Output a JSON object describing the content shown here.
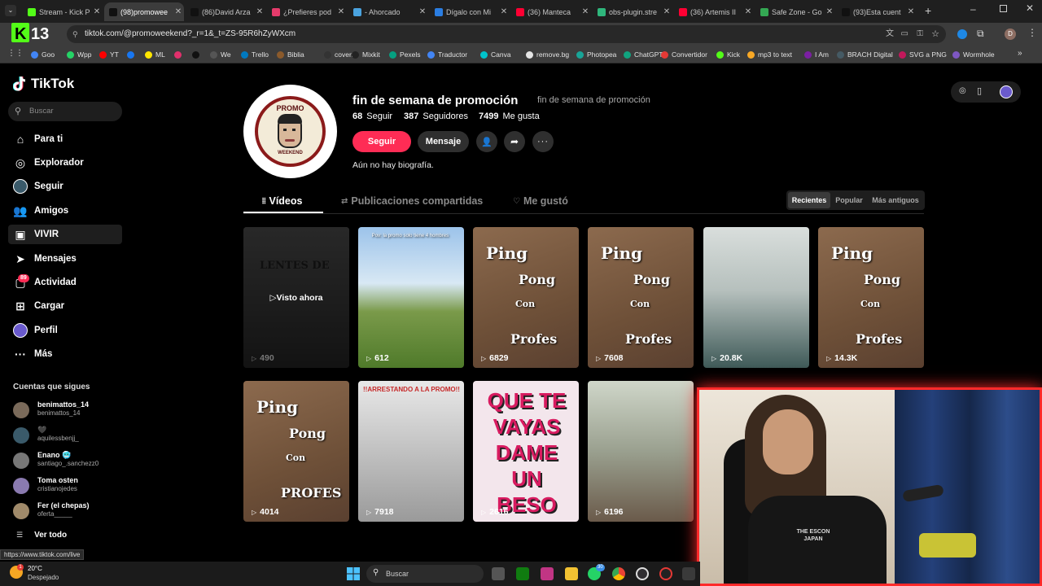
{
  "browser": {
    "tabs": [
      {
        "label": "Stream - Kick P",
        "color": "#53fc18",
        "active": false
      },
      {
        "label": "(98)promowee",
        "color": "#111111",
        "active": true
      },
      {
        "label": "(86)David Arza",
        "color": "#111111",
        "active": false
      },
      {
        "label": "¿Prefieres pod",
        "color": "#e53b6b",
        "active": false
      },
      {
        "label": "- Ahorcado",
        "color": "#4aa3df",
        "active": false
      },
      {
        "label": "Dígalo con Mi",
        "color": "#2a7de1",
        "active": false
      },
      {
        "label": "(36) Manteca",
        "color": "#ff0033",
        "active": false
      },
      {
        "label": "obs-plugin.stre",
        "color": "#2fb67c",
        "active": false
      },
      {
        "label": "(36) Artemis II",
        "color": "#ff0033",
        "active": false
      },
      {
        "label": "Safe Zone - Go",
        "color": "#34a853",
        "active": false
      },
      {
        "label": "(93)Esta cuent",
        "color": "#111111",
        "active": false
      }
    ],
    "url": "tiktok.com/@promoweekend?_r=1&_t=ZS-95R6hZyWXcm",
    "bookmarks": [
      {
        "label": "Goo",
        "color": "#4285f4"
      },
      {
        "label": "Wpp",
        "color": "#25d366"
      },
      {
        "label": "YT",
        "color": "#ff0000"
      },
      {
        "label": "",
        "color": "#1877f2"
      },
      {
        "label": "ML",
        "color": "#ffe600"
      },
      {
        "label": "",
        "color": "#e1306c"
      },
      {
        "label": "",
        "color": "#111111"
      },
      {
        "label": "We",
        "color": "#555555"
      },
      {
        "label": "Trello",
        "color": "#0079bf"
      },
      {
        "label": "Biblia",
        "color": "#8b5a2b"
      },
      {
        "label": "coverr",
        "color": "#333333"
      },
      {
        "label": "Mixkit",
        "color": "#222222"
      },
      {
        "label": "Pexels",
        "color": "#05a081"
      },
      {
        "label": "Traductor",
        "color": "#4285f4"
      },
      {
        "label": "Canva",
        "color": "#00c4cc"
      },
      {
        "label": "remove.bg",
        "color": "#e5e5e5"
      },
      {
        "label": "Photopea",
        "color": "#18a497"
      },
      {
        "label": "ChatGPT",
        "color": "#10a37f"
      },
      {
        "label": "Convertidor",
        "color": "#e53935"
      },
      {
        "label": "Kick",
        "color": "#53fc18"
      },
      {
        "label": "mp3 to text",
        "color": "#f9a825"
      },
      {
        "label": "I Am",
        "color": "#7b1fa2"
      },
      {
        "label": "BRACH Digital",
        "color": "#455a64"
      },
      {
        "label": "SVG a PNG",
        "color": "#c2185b"
      },
      {
        "label": "Wormhole",
        "color": "#7e57c2"
      }
    ],
    "status_url": "https://www.tiktok.com/live"
  },
  "sidebar": {
    "logo": "TikTok",
    "search_placeholder": "Buscar",
    "items": [
      {
        "label": "Para ti",
        "icon": "home-icon"
      },
      {
        "label": "Explorador",
        "icon": "compass-icon"
      },
      {
        "label": "Seguir",
        "icon": "following-icon"
      },
      {
        "label": "Amigos",
        "icon": "friends-icon"
      },
      {
        "label": "VIVIR",
        "icon": "live-icon"
      },
      {
        "label": "Mensajes",
        "icon": "messages-icon"
      },
      {
        "label": "Actividad",
        "icon": "activity-icon"
      },
      {
        "label": "Cargar",
        "icon": "upload-icon"
      },
      {
        "label": "Perfil",
        "icon": "profile-icon"
      },
      {
        "label": "Más",
        "icon": "more-icon"
      }
    ],
    "activity_badge": "89",
    "following_title": "Cuentas que sigues",
    "following": [
      {
        "name": "benimattos_14",
        "user": "benimattos_14",
        "color": "#7a6a5a"
      },
      {
        "name": "🖤",
        "user": "aquilessbenjj_",
        "color": "#3a5a6a"
      },
      {
        "name": "Enano 🥶",
        "user": "santiago_.sanchezz0",
        "color": "#777777"
      },
      {
        "name": "Toma osten",
        "user": "cristianojedes",
        "color": "#8a7ab0"
      },
      {
        "name": "Fer (el chepas)",
        "user": "oferta_____",
        "color": "#a08a6a"
      }
    ],
    "see_all": "Ver todo"
  },
  "profile": {
    "username": "fin de semana de promoción",
    "nickname": "fin de semana de promoción",
    "avatar_text": "PROMO",
    "avatar_subtext": "WEEKEND",
    "following_count": "68",
    "following_label": "Seguir",
    "followers_count": "387",
    "followers_label": "Seguidores",
    "likes_count": "7499",
    "likes_label": "Me gusta",
    "follow_button": "Seguir",
    "message_button": "Mensaje",
    "bio": "Aún no hay biografía."
  },
  "tabs": {
    "videos": "Vídeos",
    "reposts": "Publicaciones compartidas",
    "liked": "Me gustó"
  },
  "sort": {
    "options": [
      "Recientes",
      "Popular",
      "Más antiguos"
    ],
    "selected": "Recientes"
  },
  "videos": [
    {
      "views": "490",
      "overlay": "LENTES DE",
      "watched_label": "Visto ahora",
      "bg": "#3a3a3a"
    },
    {
      "views": "612",
      "overlay": "Pov: la promo solo tiene 4 hombres",
      "bg": "#5a7a3a"
    },
    {
      "views": "6829",
      "overlay_lines": [
        "Ping",
        "Pong",
        "Con",
        "Profes"
      ],
      "bg": "#7a5a40"
    },
    {
      "views": "7608",
      "overlay_lines": [
        "Ping",
        "Pong",
        "Con",
        "Profes"
      ],
      "bg": "#7a5a40"
    },
    {
      "views": "20.8K",
      "overlay": "",
      "bg": "#5a6a6a"
    },
    {
      "views": "14.3K",
      "overlay_lines": [
        "Ping",
        "Pong",
        "Con",
        "Profes"
      ],
      "bg": "#7a5a40"
    },
    {
      "views": "4014",
      "overlay_lines": [
        "Ping",
        "Pong",
        "Con",
        "PROFES"
      ],
      "bg": "#7a5a40"
    },
    {
      "views": "7918",
      "overlay": "!!ARRESTANDO A LA PROMO!!",
      "bg": "#bdbdbd"
    },
    {
      "views": "2616",
      "overlay": "QUE TE VAYAS DAME UN BESO",
      "bg": "#efe6ea"
    },
    {
      "views": "6196",
      "overlay": "",
      "bg": "#8a8a7a"
    }
  ],
  "webcam": {
    "shirt_text": "THE ESCON JAPAN"
  },
  "taskbar": {
    "weather_temp": "20°C",
    "weather_desc": "Despejado",
    "search_placeholder": "Buscar",
    "badge": "30"
  }
}
